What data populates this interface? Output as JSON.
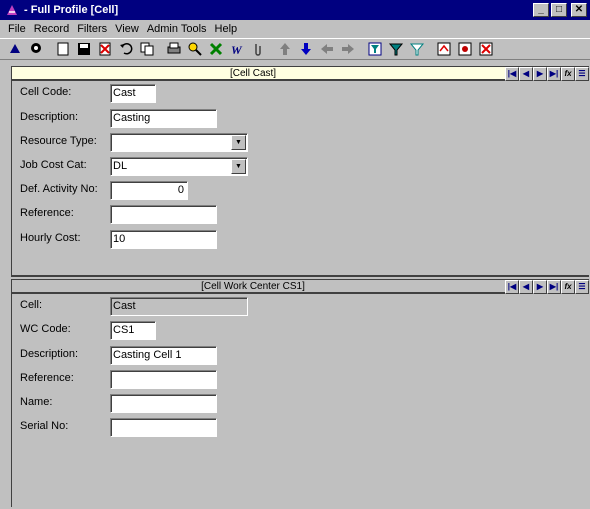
{
  "window": {
    "title": "- Full Profile [Cell]",
    "minimize": "_",
    "maximize": "□",
    "close": "✕"
  },
  "menu": [
    "File",
    "Record",
    "Filters",
    "View",
    "Admin Tools",
    "Help"
  ],
  "panel_top": {
    "title": "[Cell Cast]",
    "fields": {
      "cell_code": {
        "label": "Cell Code:",
        "value": "Cast"
      },
      "description": {
        "label": "Description:",
        "value": "Casting"
      },
      "resource_type": {
        "label": "Resource Type:",
        "value": ""
      },
      "job_cost_cat": {
        "label": "Job Cost Cat:",
        "value": "DL"
      },
      "def_activity_no": {
        "label": "Def. Activity No:",
        "value": "0"
      },
      "reference": {
        "label": "Reference:",
        "value": ""
      },
      "hourly_cost": {
        "label": "Hourly Cost:",
        "value": "10"
      }
    }
  },
  "panel_bottom": {
    "title": "[Cell Work Center CS1]",
    "fields": {
      "cell": {
        "label": "Cell:",
        "value": "Cast"
      },
      "wc_code": {
        "label": "WC Code:",
        "value": "CS1"
      },
      "description": {
        "label": "Description:",
        "value": "Casting Cell 1"
      },
      "reference": {
        "label": "Reference:",
        "value": ""
      },
      "name": {
        "label": "Name:",
        "value": ""
      },
      "serial_no": {
        "label": "Serial No:",
        "value": ""
      }
    }
  },
  "nav_glyphs": {
    "first": "|◀",
    "prev": "◀",
    "next": "▶",
    "last": "▶|",
    "fx": "fx",
    "list": "☰"
  }
}
